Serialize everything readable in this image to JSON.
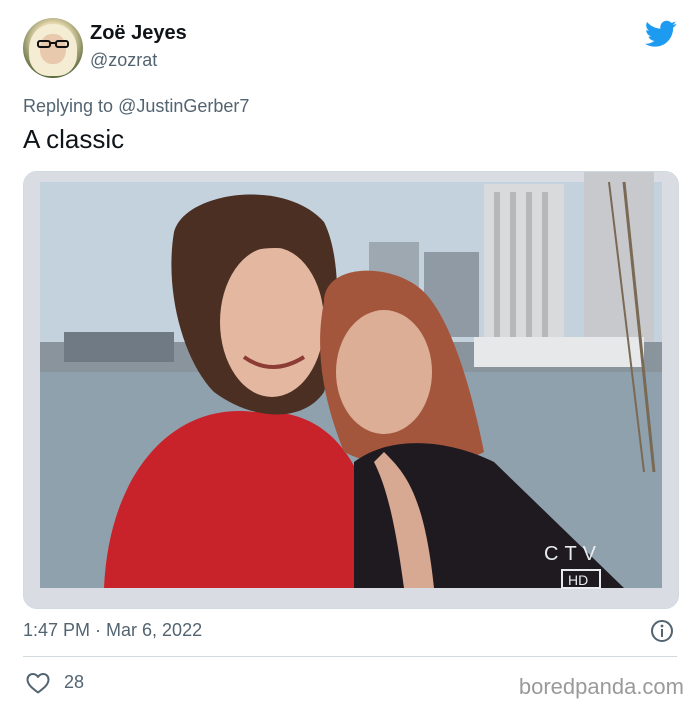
{
  "author": {
    "display_name": "Zoë Jeyes",
    "handle": "@zozrat"
  },
  "reply": {
    "prefix": "Replying to",
    "mention": "@JustinGerber7"
  },
  "tweet": {
    "text": "A classic",
    "timestamp": "1:47 PM · Mar 6, 2022",
    "likes": "28"
  },
  "photo": {
    "overlay_network": "CTV",
    "overlay_hd": "HD"
  },
  "watermark": "boredpanda.com",
  "icons": {
    "brand": "twitter-bird-icon",
    "info": "info-icon",
    "like": "heart-icon"
  },
  "colors": {
    "twitter_blue": "#1d9bf0",
    "secondary_text": "#536471",
    "primary_text": "#0f1419"
  }
}
